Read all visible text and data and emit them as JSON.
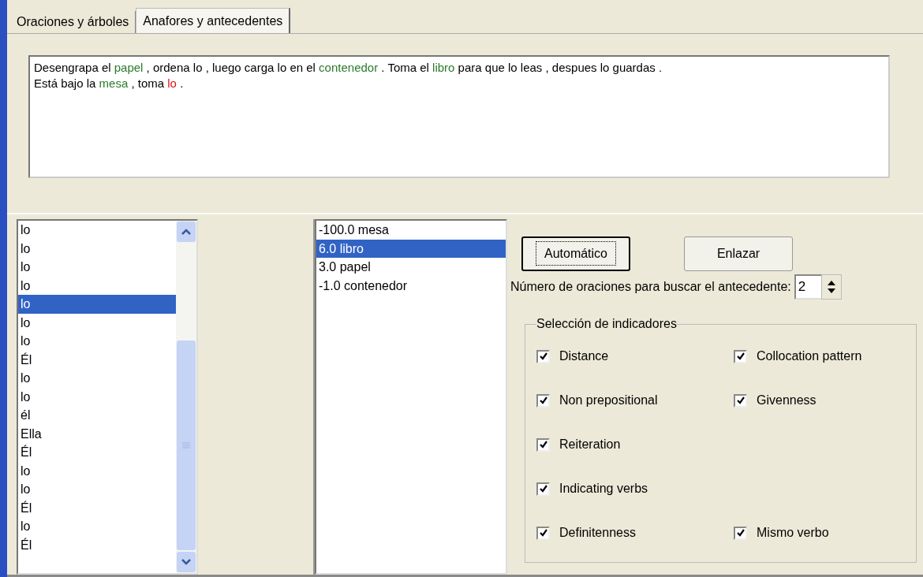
{
  "tabs": [
    {
      "label": "Oraciones y árboles",
      "selected": false
    },
    {
      "label": "Anafores y antecedentes",
      "selected": true
    }
  ],
  "text_area": {
    "lines": [
      [
        {
          "text": "Desengrapa el ",
          "kind": "plain"
        },
        {
          "text": "papel",
          "kind": "antecedent"
        },
        {
          "text": " , ordena lo , luego carga lo en el ",
          "kind": "plain"
        },
        {
          "text": "contenedor",
          "kind": "antecedent"
        },
        {
          "text": " . Toma el ",
          "kind": "plain"
        },
        {
          "text": "libro",
          "kind": "antecedent"
        },
        {
          "text": " para que lo leas , despues lo guardas .",
          "kind": "plain"
        }
      ],
      [
        {
          "text": "Está bajo la ",
          "kind": "plain"
        },
        {
          "text": "mesa",
          "kind": "antecedent"
        },
        {
          "text": " , toma ",
          "kind": "plain"
        },
        {
          "text": "lo",
          "kind": "anaphor"
        },
        {
          "text": " .",
          "kind": "plain"
        }
      ]
    ]
  },
  "anaphors": [
    {
      "label": "lo",
      "selected": false
    },
    {
      "label": "lo",
      "selected": false
    },
    {
      "label": "lo",
      "selected": false
    },
    {
      "label": "lo",
      "selected": false
    },
    {
      "label": "lo",
      "selected": true
    },
    {
      "label": "lo",
      "selected": false
    },
    {
      "label": "lo",
      "selected": false
    },
    {
      "label": "Él",
      "selected": false
    },
    {
      "label": "lo",
      "selected": false
    },
    {
      "label": "lo",
      "selected": false
    },
    {
      "label": "él",
      "selected": false
    },
    {
      "label": "Ella",
      "selected": false
    },
    {
      "label": "Él",
      "selected": false
    },
    {
      "label": "lo",
      "selected": false
    },
    {
      "label": "lo",
      "selected": false
    },
    {
      "label": "Él",
      "selected": false
    },
    {
      "label": "lo",
      "selected": false
    },
    {
      "label": "Él",
      "selected": false
    }
  ],
  "antecedents": [
    {
      "label": "-100.0 mesa",
      "selected": false
    },
    {
      "label": "6.0 libro",
      "selected": true
    },
    {
      "label": "3.0 papel",
      "selected": false
    },
    {
      "label": "-1.0 contenedor",
      "selected": false
    }
  ],
  "buttons": [
    {
      "label": "Automático",
      "focused": true
    },
    {
      "label": "Enlazar",
      "focused": false
    }
  ],
  "sentence_count": {
    "label": "Número de oraciones para buscar el antecedente:",
    "value": "2"
  },
  "indicators": {
    "title": "Selección de indicadores",
    "rows": [
      {
        "items": [
          {
            "label": "Distance",
            "checked": true
          },
          {
            "label": "Collocation pattern",
            "checked": true
          }
        ]
      },
      {
        "items": [
          {
            "label": "Non prepositional",
            "checked": true
          },
          {
            "label": "Givenness",
            "checked": true
          }
        ]
      },
      {
        "items": [
          {
            "label": "Reiteration",
            "checked": true
          }
        ]
      },
      {
        "items": [
          {
            "label": "Indicating verbs",
            "checked": true
          }
        ]
      },
      {
        "items": [
          {
            "label": "Definitenness",
            "checked": true
          },
          {
            "label": "Mismo verbo",
            "checked": true
          }
        ]
      }
    ]
  }
}
